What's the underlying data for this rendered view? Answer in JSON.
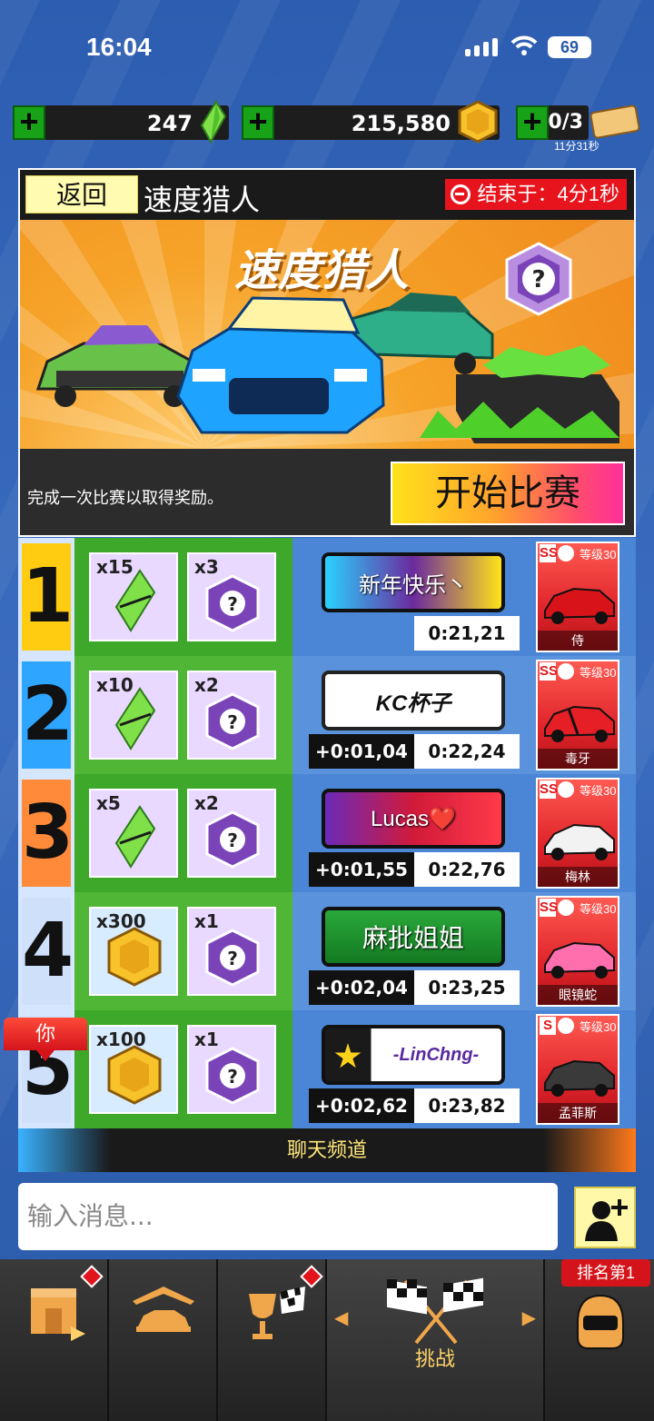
{
  "status_bar": {
    "time": "16:04",
    "battery": "69"
  },
  "currency": {
    "gems": "247",
    "coins": "215,580",
    "tickets": "0/3",
    "ticket_timer": "11分31秒"
  },
  "header": {
    "back_label": "返回",
    "title": "速度猎人",
    "timer_label": "结束于：4分1秒"
  },
  "banner": {
    "title": "速度猎人"
  },
  "event": {
    "description": "完成一次比赛以取得奖励。",
    "start_label": "开始比赛"
  },
  "leaderboard": [
    {
      "rank": "1",
      "reward1": "x15",
      "reward2": "x3",
      "player": "新年快乐丶",
      "delta": "",
      "time": "0:21,21",
      "car_class": "SS",
      "level": "等级30",
      "car": "侍"
    },
    {
      "rank": "2",
      "reward1": "x10",
      "reward2": "x2",
      "player": "KC杯子",
      "delta": "+0:01,04",
      "time": "0:22,24",
      "car_class": "SS",
      "level": "等级30",
      "car": "毒牙"
    },
    {
      "rank": "3",
      "reward1": "x5",
      "reward2": "x2",
      "player": "Lucas❤️",
      "delta": "+0:01,55",
      "time": "0:22,76",
      "car_class": "SS",
      "level": "等级30",
      "car": "梅林"
    },
    {
      "rank": "4",
      "reward1": "x300",
      "reward2": "x1",
      "player": "麻批姐姐",
      "delta": "+0:02,04",
      "time": "0:23,25",
      "car_class": "SS",
      "level": "等级30",
      "car": "眼镜蛇"
    },
    {
      "rank": "5",
      "reward1": "x100",
      "reward2": "x1",
      "player": "-LinChng-",
      "delta": "+0:02,62",
      "time": "0:23,82",
      "car_class": "S",
      "level": "等级30",
      "car": "孟菲斯"
    }
  ],
  "you_label": "你",
  "chat": {
    "title": "聊天频道",
    "placeholder": "输入消息..."
  },
  "nav": {
    "challenge_label": "挑战",
    "rank_label": "排名第1"
  },
  "colors": {
    "rank1": "#ffcc11",
    "rank2": "#2ea6ff",
    "rank3": "#ff8a3a",
    "reward_green": "#3da82a",
    "accent_red": "#e1151b"
  }
}
